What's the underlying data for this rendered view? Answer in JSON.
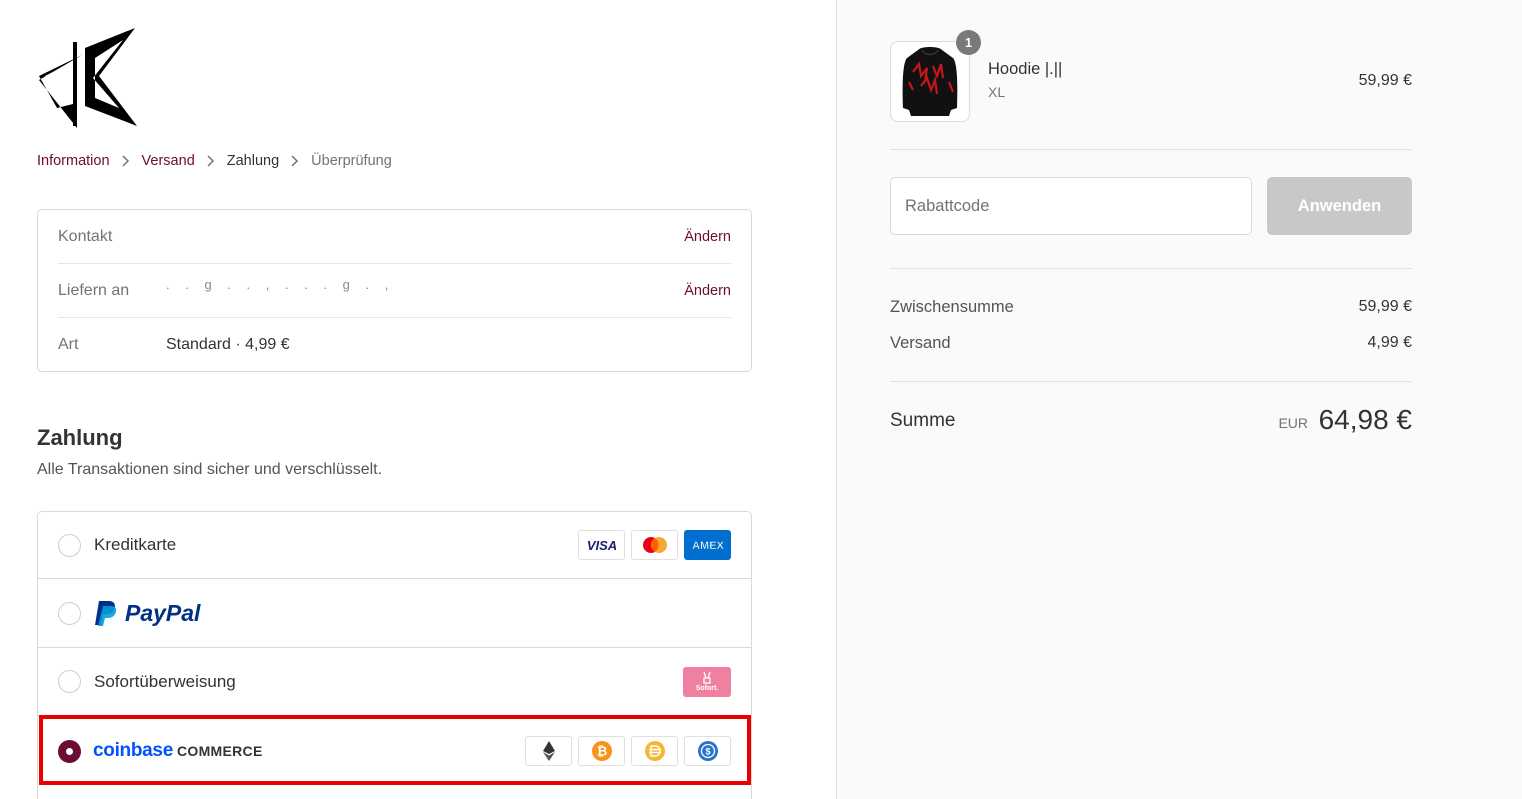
{
  "breadcrumb": {
    "items": [
      "Information",
      "Versand",
      "Zahlung",
      "Überprüfung"
    ]
  },
  "review": {
    "contact_label": "Kontakt",
    "contact_change": "Ändern",
    "ship_label": "Liefern an",
    "ship_value": ". . g . . , . . . g . ,",
    "ship_change": "Ändern",
    "method_label": "Art",
    "method_value": "Standard · 4,99 €"
  },
  "payment": {
    "heading": "Zahlung",
    "subtitle": "Alle Transaktionen sind sicher und verschlüsselt.",
    "options": [
      {
        "label": "Kreditkarte",
        "selected": false
      },
      {
        "label": "PayPal",
        "selected": false
      },
      {
        "label": "Sofortüberweisung",
        "selected": false
      },
      {
        "label": "coinbase COMMERCE",
        "selected": true
      }
    ],
    "card_icons": [
      "visa-icon",
      "mastercard-icon",
      "amex-icon"
    ],
    "sofort_badge": "Sofort.",
    "crypto_icons": [
      "ethereum-icon",
      "bitcoin-icon",
      "dai-icon",
      "usdc-icon"
    ],
    "visa_text": "VISA",
    "amex_text": "AMEX",
    "paypal_text": "PayPal",
    "coinbase_text": "coinbase",
    "commerce_text": "COMMERCE"
  },
  "order": {
    "product_name": "Hoodie |.||",
    "product_variant": "XL",
    "product_price": "59,99 €",
    "quantity": "1",
    "discount_placeholder": "Rabattcode",
    "apply_label": "Anwenden",
    "subtotal_label": "Zwischensumme",
    "subtotal_value": "59,99 €",
    "shipping_label": "Versand",
    "shipping_value": "4,99 €",
    "total_label": "Summe",
    "total_currency": "EUR",
    "total_value": "64,98 €"
  },
  "colors": {
    "accent": "#6b0d34",
    "highlight": "#e60000",
    "paypal_dark": "#003087",
    "paypal_light": "#009cde",
    "coinbase_blue": "#0052ff",
    "sofort_pink": "#ef809f"
  }
}
